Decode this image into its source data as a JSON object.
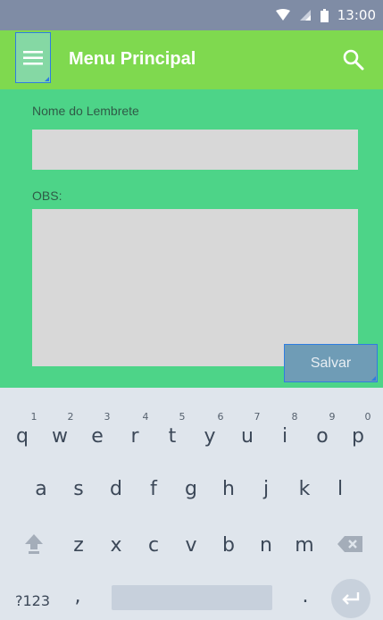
{
  "status_bar": {
    "time": "13:00"
  },
  "app_bar": {
    "title": "Menu Principal"
  },
  "form": {
    "name_label": "Nome do Lembrete",
    "name_value": "",
    "obs_label": "OBS:",
    "obs_value": "",
    "save_label": "Salvar"
  },
  "keyboard": {
    "row1": [
      "q",
      "w",
      "e",
      "r",
      "t",
      "y",
      "u",
      "i",
      "o",
      "p"
    ],
    "row1_hints": [
      "1",
      "2",
      "3",
      "4",
      "5",
      "6",
      "7",
      "8",
      "9",
      "0"
    ],
    "row2": [
      "a",
      "s",
      "d",
      "f",
      "g",
      "h",
      "j",
      "k",
      "l"
    ],
    "row3": [
      "z",
      "x",
      "c",
      "v",
      "b",
      "n",
      "m"
    ],
    "symbols_label": "?123",
    "comma": ",",
    "period": "."
  },
  "colors": {
    "status_bar": "#7f8ca5",
    "app_bar": "#7fd94f",
    "content_bg": "#4dd488",
    "input_bg": "#d8d8d8",
    "button_bg": "#6f9cb6",
    "focus_border": "#2f7de0",
    "keyboard_bg": "#dfe5ec"
  },
  "icons": {
    "menu": "hamburger-menu-icon",
    "search": "search-icon",
    "wifi": "wifi-icon",
    "signal": "cell-signal-icon",
    "battery": "battery-icon",
    "shift": "shift-icon",
    "backspace": "backspace-icon",
    "enter": "enter-icon"
  }
}
